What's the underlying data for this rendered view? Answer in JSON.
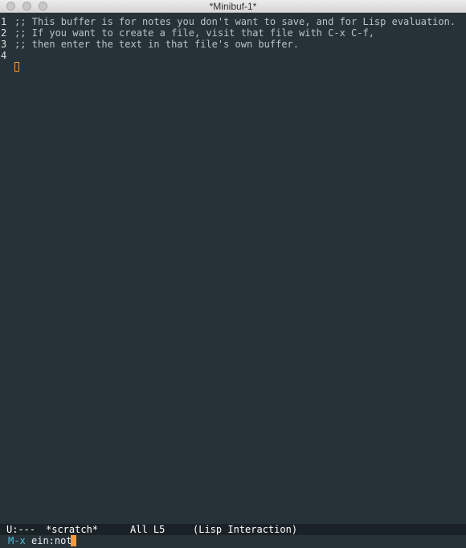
{
  "window": {
    "title": "*Minibuf-1*"
  },
  "buffer": {
    "lines": [
      {
        "number": "1",
        "text": ";; This buffer is for notes you don't want to save, and for Lisp evaluation."
      },
      {
        "number": "2",
        "text": ";; If you want to create a file, visit that file with C-x C-f,"
      },
      {
        "number": "3",
        "text": ";; then enter the text in that file's own buffer."
      },
      {
        "number": "4",
        "text": ""
      }
    ]
  },
  "modeline": {
    "status": "U:---",
    "buffer_name": "*scratch*",
    "position": "All L5",
    "mode": "(Lisp Interaction)"
  },
  "minibuffer": {
    "prompt": "M-x",
    "input": "ein:not"
  },
  "colors": {
    "background": "#263238",
    "cursor": "#f39c3d",
    "prompt": "#4fc3d8"
  }
}
